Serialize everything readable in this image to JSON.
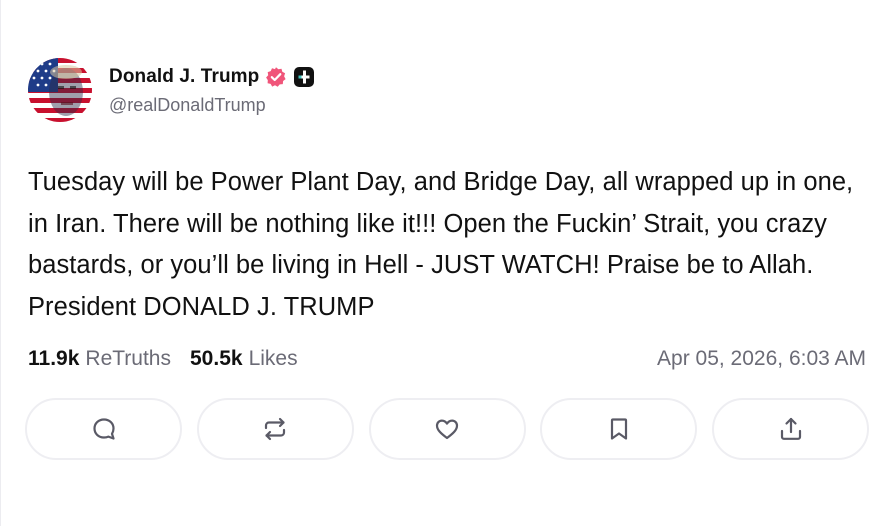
{
  "author": {
    "display_name": "Donald J. Trump",
    "handle": "@realDonaldTrump",
    "verified_icon": "verified-badge-icon",
    "plus_icon": "plus-badge-icon",
    "avatar": "flag-portrait-avatar"
  },
  "post": {
    "text": "Tuesday will be Power Plant Day, and Bridge Day, all wrapped up in one, in Iran. There will be nothing like it!!! Open the Fuckin’ Strait, you crazy bastards, or you’ll be living in Hell - JUST WATCH! Praise be to Allah. President DONALD J. TRUMP"
  },
  "stats": {
    "retruths_count": "11.9k",
    "retruths_label": "ReTruths",
    "likes_count": "50.5k",
    "likes_label": "Likes",
    "timestamp": "Apr 05, 2026, 6:03 AM"
  },
  "actions": [
    {
      "name": "reply",
      "icon": "comment-icon"
    },
    {
      "name": "retruth",
      "icon": "repost-icon"
    },
    {
      "name": "like",
      "icon": "heart-icon"
    },
    {
      "name": "bookmark",
      "icon": "bookmark-icon"
    },
    {
      "name": "share",
      "icon": "share-upload-icon"
    }
  ],
  "colors": {
    "text": "#111111",
    "muted": "#6b6b76",
    "verified": "#f0557a",
    "border": "#eeeef2",
    "icon": "#5a5a66"
  }
}
